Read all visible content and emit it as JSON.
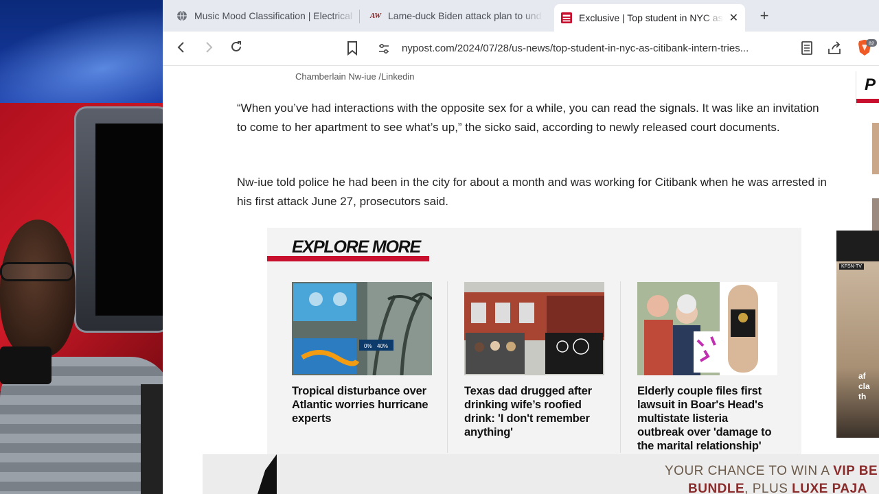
{
  "tabs": [
    {
      "title": "Music Mood Classification | Electrical"
    },
    {
      "title": "Lame-duck Biden attack plan to und",
      "favicon_text": "AW"
    },
    {
      "title": "Exclusive | Top student in NYC as",
      "favicon_text": "NEW YORK POST",
      "active": true
    }
  ],
  "address_bar": {
    "url": "nypost.com/2024/07/28/us-news/top-student-in-nyc-as-citibank-intern-tries..."
  },
  "brave_badge": "82",
  "article": {
    "photo_caption": "Chamberlain Nw-iue /Linkedin",
    "paragraphs": [
      "“When you’ve had interactions with the opposite sex for a while, you can read the signals. It was like an invitation to come to her apartment to see what’s up,” the sicko said, according to newly released court documents.",
      "Nw-iue told police he had been in the city for about a month and was working for Citibank when he was arrested in his first attack June 27, prosecutors said."
    ]
  },
  "explore_more": {
    "heading": "EXPLORE MORE",
    "cards": [
      {
        "headline": "Tropical disturbance over Atlantic worries hurricane experts",
        "pct1": "0%",
        "pct2": "40%"
      },
      {
        "headline": "Texas dad drugged after drinking wife’s roofied drink: 'I don't remember anything'"
      },
      {
        "headline": "Elderly couple files first lawsuit in Boar's Head's multistate listeria outbreak over 'damage to the marital relationship'"
      }
    ]
  },
  "right_rail": {
    "letter": "P"
  },
  "video_ad": {
    "tag": "KFSN-TV",
    "overlay_text": "af cla th"
  },
  "bottom_ad": {
    "line1_pre": "YOUR CHANCE TO WIN A ",
    "line1_highlight": "VIP BE",
    "line2_a": "BUNDLE",
    "line2_b": ", PLUS ",
    "line2_c": "LUXE PAJA"
  },
  "colors": {
    "brand_red": "#c8102e",
    "tabstrip": "#e6e9ef"
  }
}
